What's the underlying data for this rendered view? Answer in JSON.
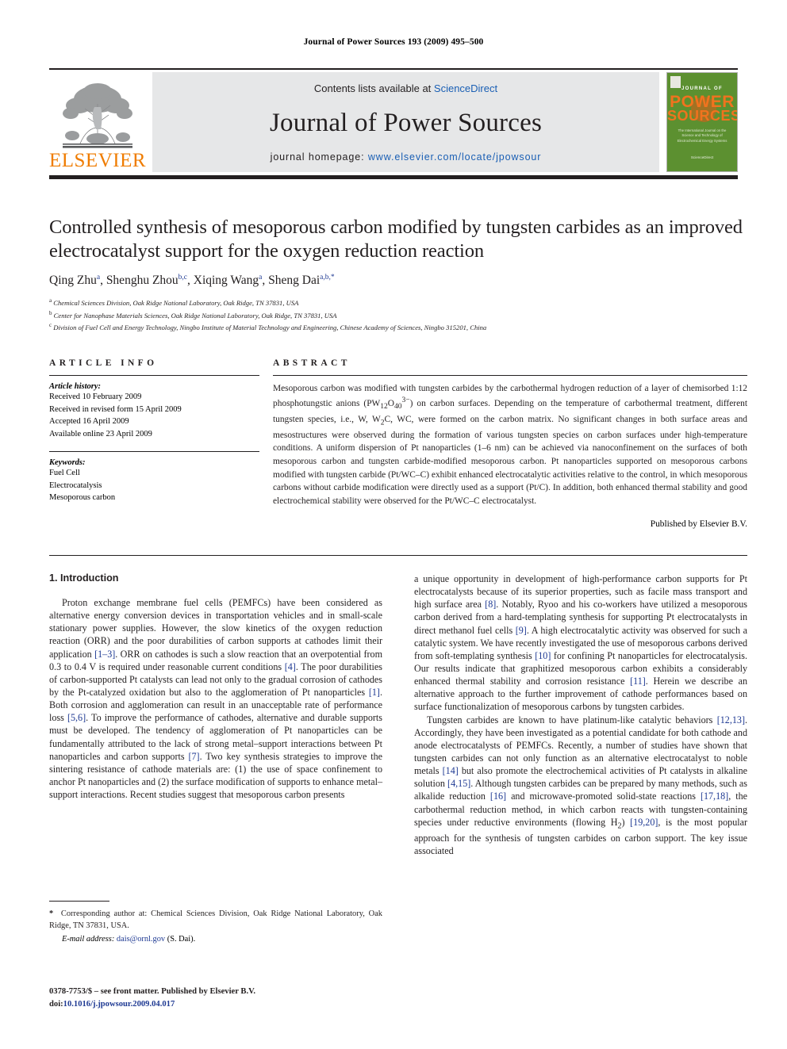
{
  "running_head": "Journal of Power Sources 193 (2009) 495–500",
  "masthead": {
    "contents_prefix": "Contents lists available at ",
    "sciencedirect": "ScienceDirect",
    "journal_name": "Journal of Power Sources",
    "homepage_prefix": "journal homepage:",
    "homepage_url": "www.elsevier.com/locate/jpowsour",
    "elsevier_wordmark": "ELSEVIER",
    "elsevier_orange": "#ef7c00",
    "link_blue": "#1a5fb4",
    "cover": {
      "journal_of": "JOURNAL OF",
      "power": "POWER",
      "sources": "SOURCES",
      "subtitle": "The International Journal on the Science and Technology of Electrochemical Energy Systems",
      "sciencedirect": "ScienceDirect",
      "bg_color": "#5c9030",
      "title_color": "#f0731e"
    }
  },
  "article": {
    "title": "Controlled synthesis of mesoporous carbon modified by tungsten carbides as an improved electrocatalyst support for the oxygen reduction reaction",
    "authors_html": "Qing Zhu<sup>a</sup>, Shenghu Zhou<sup>b,c</sup>, Xiqing Wang<sup>a</sup>, Sheng Dai<sup>a,b,</sup><sup>*</sup>",
    "affiliations": [
      {
        "marker": "a",
        "text": "Chemical Sciences Division, Oak Ridge National Laboratory, Oak Ridge, TN 37831, USA"
      },
      {
        "marker": "b",
        "text": "Center for Nanophase Materials Sciences, Oak Ridge National Laboratory, Oak Ridge, TN 37831, USA"
      },
      {
        "marker": "c",
        "text": "Division of Fuel Cell and Energy Technology, Ningbo Institute of Material Technology and Engineering, Chinese Academy of Sciences, Ningbo 315201, China"
      }
    ]
  },
  "article_info": {
    "heading": "ARTICLE INFO",
    "history_label": "Article history:",
    "history": [
      "Received 10 February 2009",
      "Received in revised form 15 April 2009",
      "Accepted 16 April 2009",
      "Available online 23 April 2009"
    ],
    "keywords_label": "Keywords:",
    "keywords": [
      "Fuel Cell",
      "Electrocatalysis",
      "Mesoporous carbon"
    ]
  },
  "abstract": {
    "heading": "ABSTRACT",
    "text_html": "Mesoporous carbon was modified with tungsten carbides by the carbothermal hydrogen reduction of a layer of chemisorbed 1:12 phosphotungstic anions (PW<sub>12</sub>O<sub>40</sub><sup>3−</sup>) on carbon surfaces. Depending on the temperature of carbothermal treatment, different tungsten species, i.e., W, W<sub>2</sub>C, WC, were formed on the carbon matrix. No significant changes in both surface areas and mesostructures were observed during the formation of various tungsten species on carbon surfaces under high-temperature conditions. A uniform dispersion of Pt nanoparticles (1–6 nm) can be achieved via nanoconfinement on the surfaces of both mesoporous carbon and tungsten carbide-modified mesoporous carbon. Pt nanoparticles supported on mesoporous carbons modified with tungsten carbide (Pt/WC–C) exhibit enhanced electrocatalytic activities relative to the control, in which mesoporous carbons without carbide modification were directly used as a support (Pt/C). In addition, both enhanced thermal stability and good electrochemical stability were observed for the Pt/WC–C electrocatalyst.",
    "publisher_note": "Published by Elsevier B.V."
  },
  "body": {
    "section_heading": "1. Introduction",
    "left_paragraph_html": "Proton exchange membrane fuel cells (PEMFCs) have been considered as alternative energy conversion devices in transportation vehicles and in small-scale stationary power supplies. However, the slow kinetics of the oxygen reduction reaction (ORR) and the poor durabilities of carbon supports at cathodes limit their application <span class=\"ref\">[1–3]</span>. ORR on cathodes is such a slow reaction that an overpotential from 0.3 to 0.4 V is required under reasonable current conditions <span class=\"ref\">[4]</span>. The poor durabilities of carbon-supported Pt catalysts can lead not only to the gradual corrosion of cathodes by the Pt-catalyzed oxidation but also to the agglomeration of Pt nanoparticles <span class=\"ref\">[1]</span>. Both corrosion and agglomeration can result in an unacceptable rate of performance loss <span class=\"ref\">[5,6]</span>. To improve the performance of cathodes, alternative and durable supports must be developed. The tendency of agglomeration of Pt nanoparticles can be fundamentally attributed to the lack of strong metal–support interactions between Pt nanoparticles and carbon supports <span class=\"ref\">[7]</span>. Two key synthesis strategies to improve the sintering resistance of cathode materials are: (1) the use of space confinement to anchor Pt nanoparticles and (2) the surface modification of supports to enhance metal–support interactions. Recent studies suggest that mesoporous carbon presents",
    "right_paragraph_1_html": "a unique opportunity in development of high-performance carbon supports for Pt electrocatalysts because of its superior properties, such as facile mass transport and high surface area <span class=\"ref\">[8]</span>. Notably, Ryoo and his co-workers have utilized a mesoporous carbon derived from a hard-templating synthesis for supporting Pt electrocatalysts in direct methanol fuel cells <span class=\"ref\">[9]</span>. A high electrocatalytic activity was observed for such a catalytic system. We have recently investigated the use of mesoporous carbons derived from soft-templating synthesis <span class=\"ref\">[10]</span> for confining Pt nanoparticles for electrocatalysis. Our results indicate that graphitized mesoporous carbon exhibits a considerably enhanced thermal stability and corrosion resistance <span class=\"ref\">[11]</span>. Herein we describe an alternative approach to the further improvement of cathode performances based on surface functionalization of mesoporous carbons by tungsten carbides.",
    "right_paragraph_2_html": "Tungsten carbides are known to have platinum-like catalytic behaviors <span class=\"ref\">[12,13]</span>. Accordingly, they have been investigated as a potential candidate for both cathode and anode electrocatalysts of PEMFCs. Recently, a number of studies have shown that tungsten carbides can not only function as an alternative electrocatalyst to noble metals <span class=\"ref\">[14]</span> but also promote the electrochemical activities of Pt catalysts in alkaline solution <span class=\"ref\">[4,15]</span>. Although tungsten carbides can be prepared by many methods, such as alkalide reduction <span class=\"ref\">[16]</span> and microwave-promoted solid-state reactions <span class=\"ref\">[17,18]</span>, the carbothermal reduction method, in which carbon reacts with tungsten-containing species under reductive environments (flowing H<sub>2</sub>) <span class=\"ref\">[19,20]</span>, is the most popular approach for the synthesis of tungsten carbides on carbon support. The key issue associated"
  },
  "footnote": {
    "corresponding_html": "<b>*</b>&nbsp; Corresponding author at: Chemical Sciences Division, Oak Ridge National Laboratory, Oak Ridge, TN 37831, USA.",
    "email_label": "E-mail address:",
    "email": "dais@ornl.gov",
    "email_suffix": "(S. Dai)."
  },
  "bottom_matter": {
    "issn_line": "0378-7753/$ – see front matter. Published by Elsevier B.V.",
    "doi_prefix": "doi:",
    "doi": "10.1016/j.jpowsour.2009.04.017"
  }
}
